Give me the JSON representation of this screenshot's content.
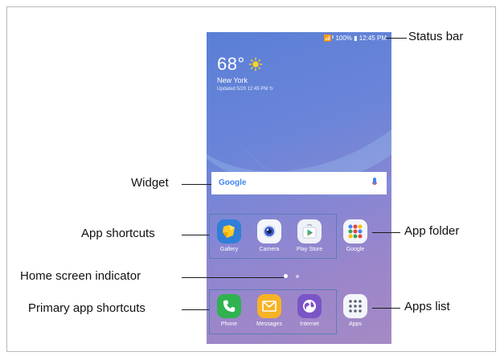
{
  "status_bar_text": "📶ᴵˡ 100% ▮ 12:45 PM",
  "weather": {
    "temperature": "68°",
    "city": "New York",
    "updated": "Updated 5/20 12:45 PM ↻"
  },
  "search_widget": {
    "logo": "Google"
  },
  "app_shortcuts": [
    {
      "label": "Gallery",
      "icon": "gallery-icon"
    },
    {
      "label": "Camera",
      "icon": "camera-icon"
    },
    {
      "label": "Play Store",
      "icon": "play-store-icon"
    }
  ],
  "folder": {
    "label": "Google",
    "icon": "google-folder-icon"
  },
  "dock": [
    {
      "label": "Phone",
      "icon": "phone-icon"
    },
    {
      "label": "Messages",
      "icon": "messages-icon"
    },
    {
      "label": "Internet",
      "icon": "internet-icon"
    }
  ],
  "apps_button": {
    "label": "Apps",
    "icon": "apps-grid-icon"
  },
  "callouts": {
    "status_bar": "Status bar",
    "widget": "Widget",
    "app_shortcuts": "App shortcuts",
    "app_folder": "App folder",
    "home_indicator": "Home screen indicator",
    "primary_shortcuts": "Primary app shortcuts",
    "apps_list": "Apps list"
  },
  "colors": {
    "wallpaper_top": "#5a7fd6",
    "wallpaper_bottom": "#a48ac4",
    "callout_box": "#5b7cb8"
  }
}
